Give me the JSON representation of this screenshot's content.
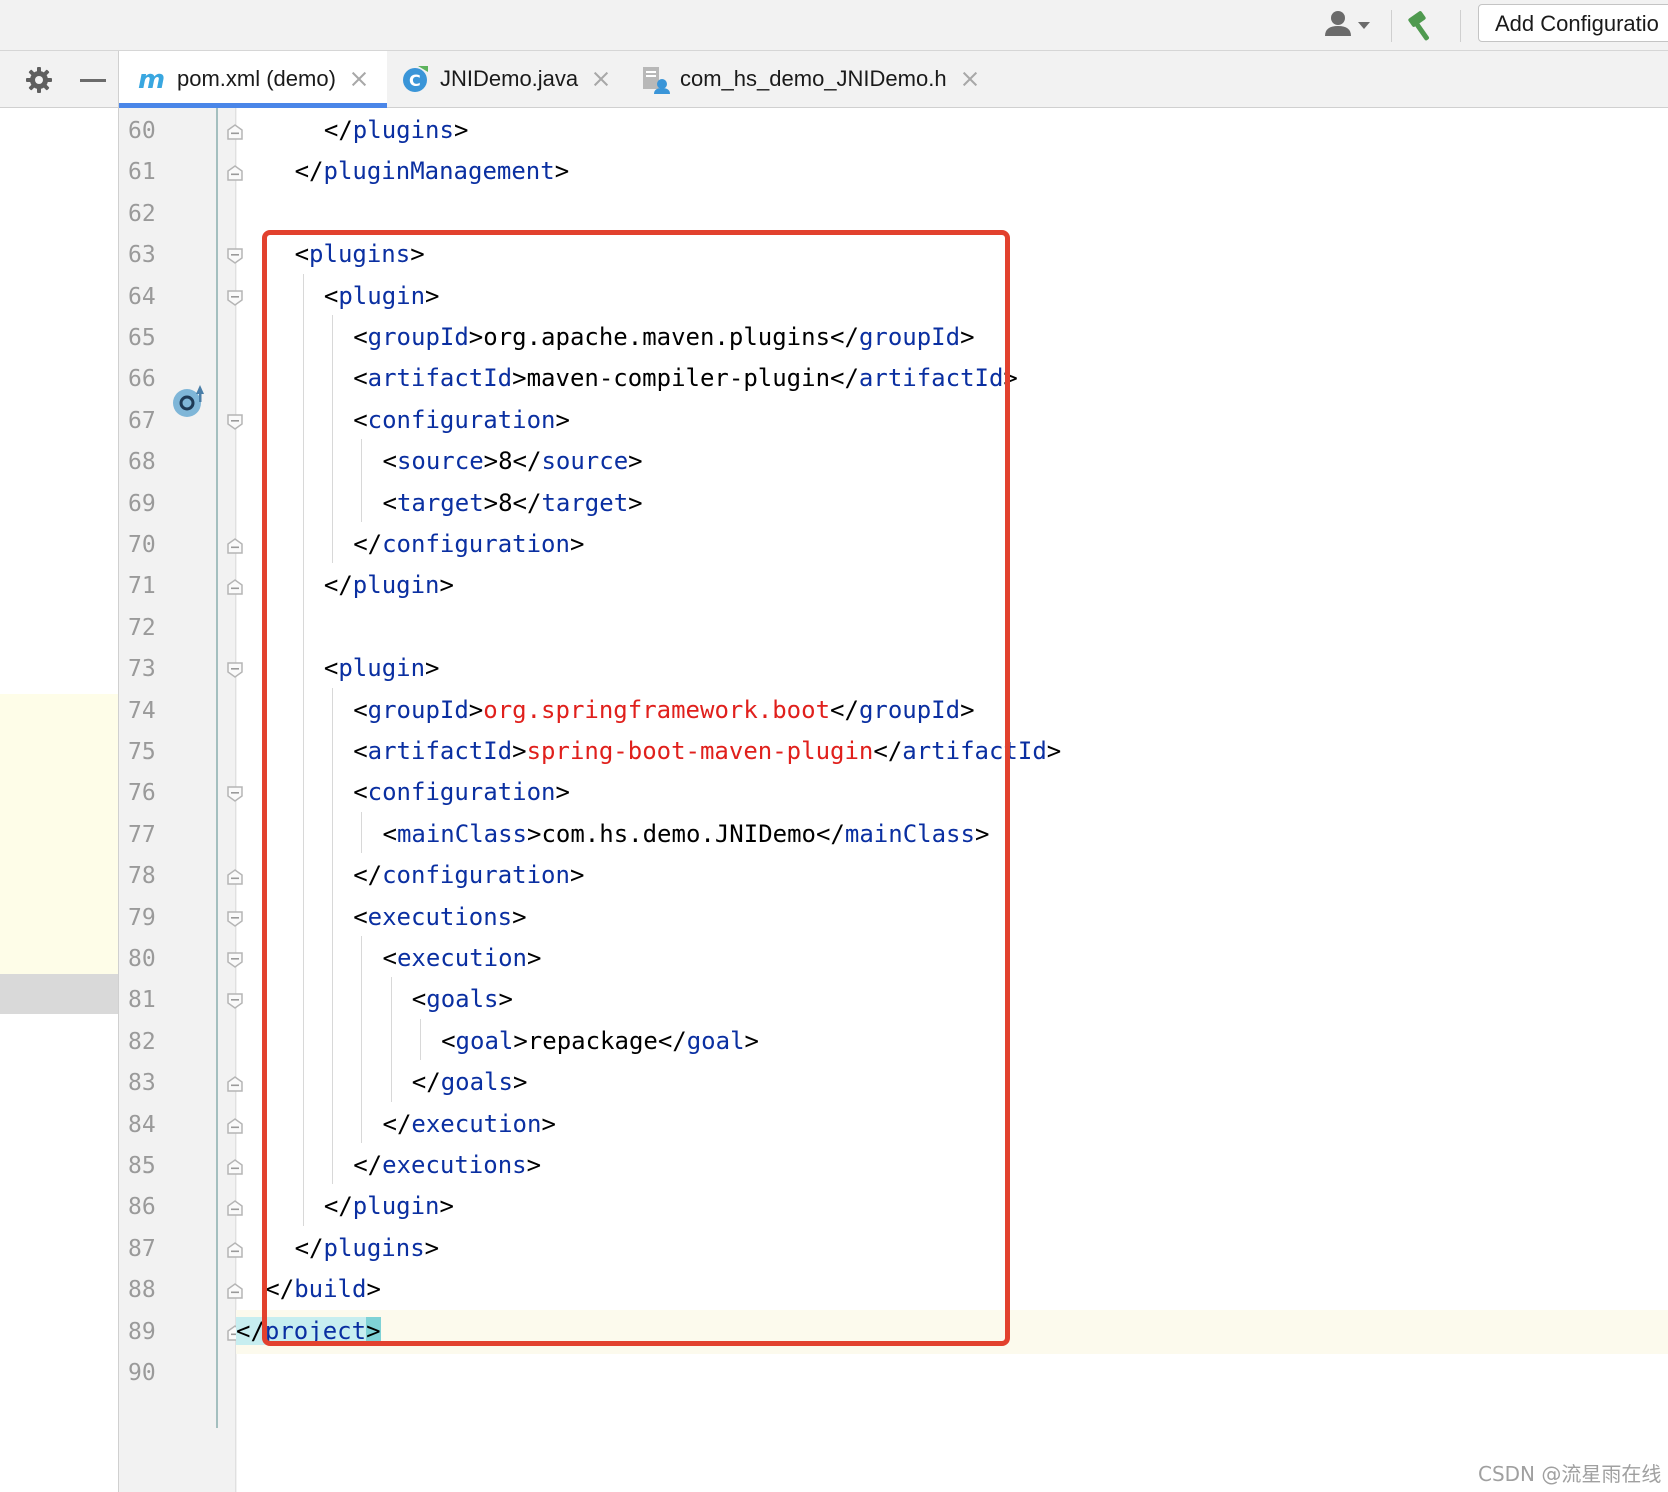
{
  "toolbar": {
    "add_configuration_label": "Add Configuratio"
  },
  "tabs": [
    {
      "label": "pom.xml (demo)",
      "icon": "maven-m-icon",
      "active": true
    },
    {
      "label": "JNIDemo.java",
      "icon": "java-class-icon",
      "active": false
    },
    {
      "label": "com_hs_demo_JNIDemo.h",
      "icon": "c-header-file-icon",
      "active": false
    }
  ],
  "editor": {
    "line_numbers": [
      "60",
      "61",
      "62",
      "63",
      "64",
      "65",
      "66",
      "67",
      "68",
      "69",
      "70",
      "71",
      "72",
      "73",
      "74",
      "75",
      "76",
      "77",
      "78",
      "79",
      "80",
      "81",
      "82",
      "83",
      "84",
      "85",
      "86",
      "87",
      "88",
      "89",
      "90"
    ],
    "current_line": "89",
    "lines": [
      {
        "indent": 3,
        "parts": [
          [
            "p",
            "</"
          ],
          [
            "t",
            "plugins"
          ],
          [
            "p",
            ">"
          ]
        ]
      },
      {
        "indent": 2,
        "parts": [
          [
            "p",
            "</"
          ],
          [
            "t",
            "pluginManagement"
          ],
          [
            "p",
            ">"
          ]
        ]
      },
      {
        "indent": 0,
        "parts": []
      },
      {
        "indent": 2,
        "parts": [
          [
            "p",
            "<"
          ],
          [
            "t",
            "plugins"
          ],
          [
            "p",
            ">"
          ]
        ]
      },
      {
        "indent": 3,
        "parts": [
          [
            "p",
            "<"
          ],
          [
            "t",
            "plugin"
          ],
          [
            "p",
            ">"
          ]
        ]
      },
      {
        "indent": 4,
        "parts": [
          [
            "p",
            "<"
          ],
          [
            "t",
            "groupId"
          ],
          [
            "p",
            ">org.apache.maven.plugins</"
          ],
          [
            "t",
            "groupId"
          ],
          [
            "p",
            ">"
          ]
        ]
      },
      {
        "indent": 4,
        "parts": [
          [
            "p",
            "<"
          ],
          [
            "t",
            "artifactId"
          ],
          [
            "p",
            ">maven-compiler-plugin</"
          ],
          [
            "t",
            "artifactId"
          ],
          [
            "p",
            ">"
          ]
        ]
      },
      {
        "indent": 4,
        "parts": [
          [
            "p",
            "<"
          ],
          [
            "t",
            "configuration"
          ],
          [
            "p",
            ">"
          ]
        ]
      },
      {
        "indent": 5,
        "parts": [
          [
            "p",
            "<"
          ],
          [
            "t",
            "source"
          ],
          [
            "p",
            ">8</"
          ],
          [
            "t",
            "source"
          ],
          [
            "p",
            ">"
          ]
        ]
      },
      {
        "indent": 5,
        "parts": [
          [
            "p",
            "<"
          ],
          [
            "t",
            "target"
          ],
          [
            "p",
            ">8</"
          ],
          [
            "t",
            "target"
          ],
          [
            "p",
            ">"
          ]
        ]
      },
      {
        "indent": 4,
        "parts": [
          [
            "p",
            "</"
          ],
          [
            "t",
            "configuration"
          ],
          [
            "p",
            ">"
          ]
        ]
      },
      {
        "indent": 3,
        "parts": [
          [
            "p",
            "</"
          ],
          [
            "t",
            "plugin"
          ],
          [
            "p",
            ">"
          ]
        ]
      },
      {
        "indent": 0,
        "parts": []
      },
      {
        "indent": 3,
        "parts": [
          [
            "p",
            "<"
          ],
          [
            "t",
            "plugin"
          ],
          [
            "p",
            ">"
          ]
        ]
      },
      {
        "indent": 4,
        "parts": [
          [
            "p",
            "<"
          ],
          [
            "t",
            "groupId"
          ],
          [
            "p",
            ">"
          ],
          [
            "r",
            "org.springframework.boot"
          ],
          [
            "p",
            "</"
          ],
          [
            "t",
            "groupId"
          ],
          [
            "p",
            ">"
          ]
        ]
      },
      {
        "indent": 4,
        "parts": [
          [
            "p",
            "<"
          ],
          [
            "t",
            "artifactId"
          ],
          [
            "p",
            ">"
          ],
          [
            "r",
            "spring-boot-maven-plugin"
          ],
          [
            "p",
            "</"
          ],
          [
            "t",
            "artifactId"
          ],
          [
            "p",
            ">"
          ]
        ]
      },
      {
        "indent": 4,
        "parts": [
          [
            "p",
            "<"
          ],
          [
            "t",
            "configuration"
          ],
          [
            "p",
            ">"
          ]
        ]
      },
      {
        "indent": 5,
        "parts": [
          [
            "p",
            "<"
          ],
          [
            "t",
            "mainClass"
          ],
          [
            "p",
            ">com.hs.demo.JNIDemo</"
          ],
          [
            "t",
            "mainClass"
          ],
          [
            "p",
            ">"
          ]
        ]
      },
      {
        "indent": 4,
        "parts": [
          [
            "p",
            "</"
          ],
          [
            "t",
            "configuration"
          ],
          [
            "p",
            ">"
          ]
        ]
      },
      {
        "indent": 4,
        "parts": [
          [
            "p",
            "<"
          ],
          [
            "t",
            "executions"
          ],
          [
            "p",
            ">"
          ]
        ]
      },
      {
        "indent": 5,
        "parts": [
          [
            "p",
            "<"
          ],
          [
            "t",
            "execution"
          ],
          [
            "p",
            ">"
          ]
        ]
      },
      {
        "indent": 6,
        "parts": [
          [
            "p",
            "<"
          ],
          [
            "t",
            "goals"
          ],
          [
            "p",
            ">"
          ]
        ]
      },
      {
        "indent": 7,
        "parts": [
          [
            "p",
            "<"
          ],
          [
            "t",
            "goal"
          ],
          [
            "p",
            ">repackage</"
          ],
          [
            "t",
            "goal"
          ],
          [
            "p",
            ">"
          ]
        ]
      },
      {
        "indent": 6,
        "parts": [
          [
            "p",
            "</"
          ],
          [
            "t",
            "goals"
          ],
          [
            "p",
            ">"
          ]
        ]
      },
      {
        "indent": 5,
        "parts": [
          [
            "p",
            "</"
          ],
          [
            "t",
            "execution"
          ],
          [
            "p",
            ">"
          ]
        ]
      },
      {
        "indent": 4,
        "parts": [
          [
            "p",
            "</"
          ],
          [
            "t",
            "executions"
          ],
          [
            "p",
            ">"
          ]
        ]
      },
      {
        "indent": 3,
        "parts": [
          [
            "p",
            "</"
          ],
          [
            "t",
            "plugin"
          ],
          [
            "p",
            ">"
          ]
        ]
      },
      {
        "indent": 2,
        "parts": [
          [
            "p",
            "</"
          ],
          [
            "t",
            "plugins"
          ],
          [
            "p",
            ">"
          ]
        ]
      },
      {
        "indent": 1,
        "parts": [
          [
            "p",
            "</"
          ],
          [
            "t",
            "build"
          ],
          [
            "p",
            ">"
          ]
        ]
      },
      {
        "indent": 0,
        "parts": [
          [
            "h",
            "</"
          ],
          [
            "ht",
            "project"
          ],
          [
            "h2",
            ">"
          ]
        ]
      },
      {
        "indent": 0,
        "parts": []
      }
    ]
  },
  "watermark": "CSDN @流星雨在线",
  "colors": {
    "tag": "#0a2fa1",
    "highlight_value": "#e0201c",
    "annotation_box": "#e2412e",
    "active_tab_underline": "#4a86e8"
  }
}
